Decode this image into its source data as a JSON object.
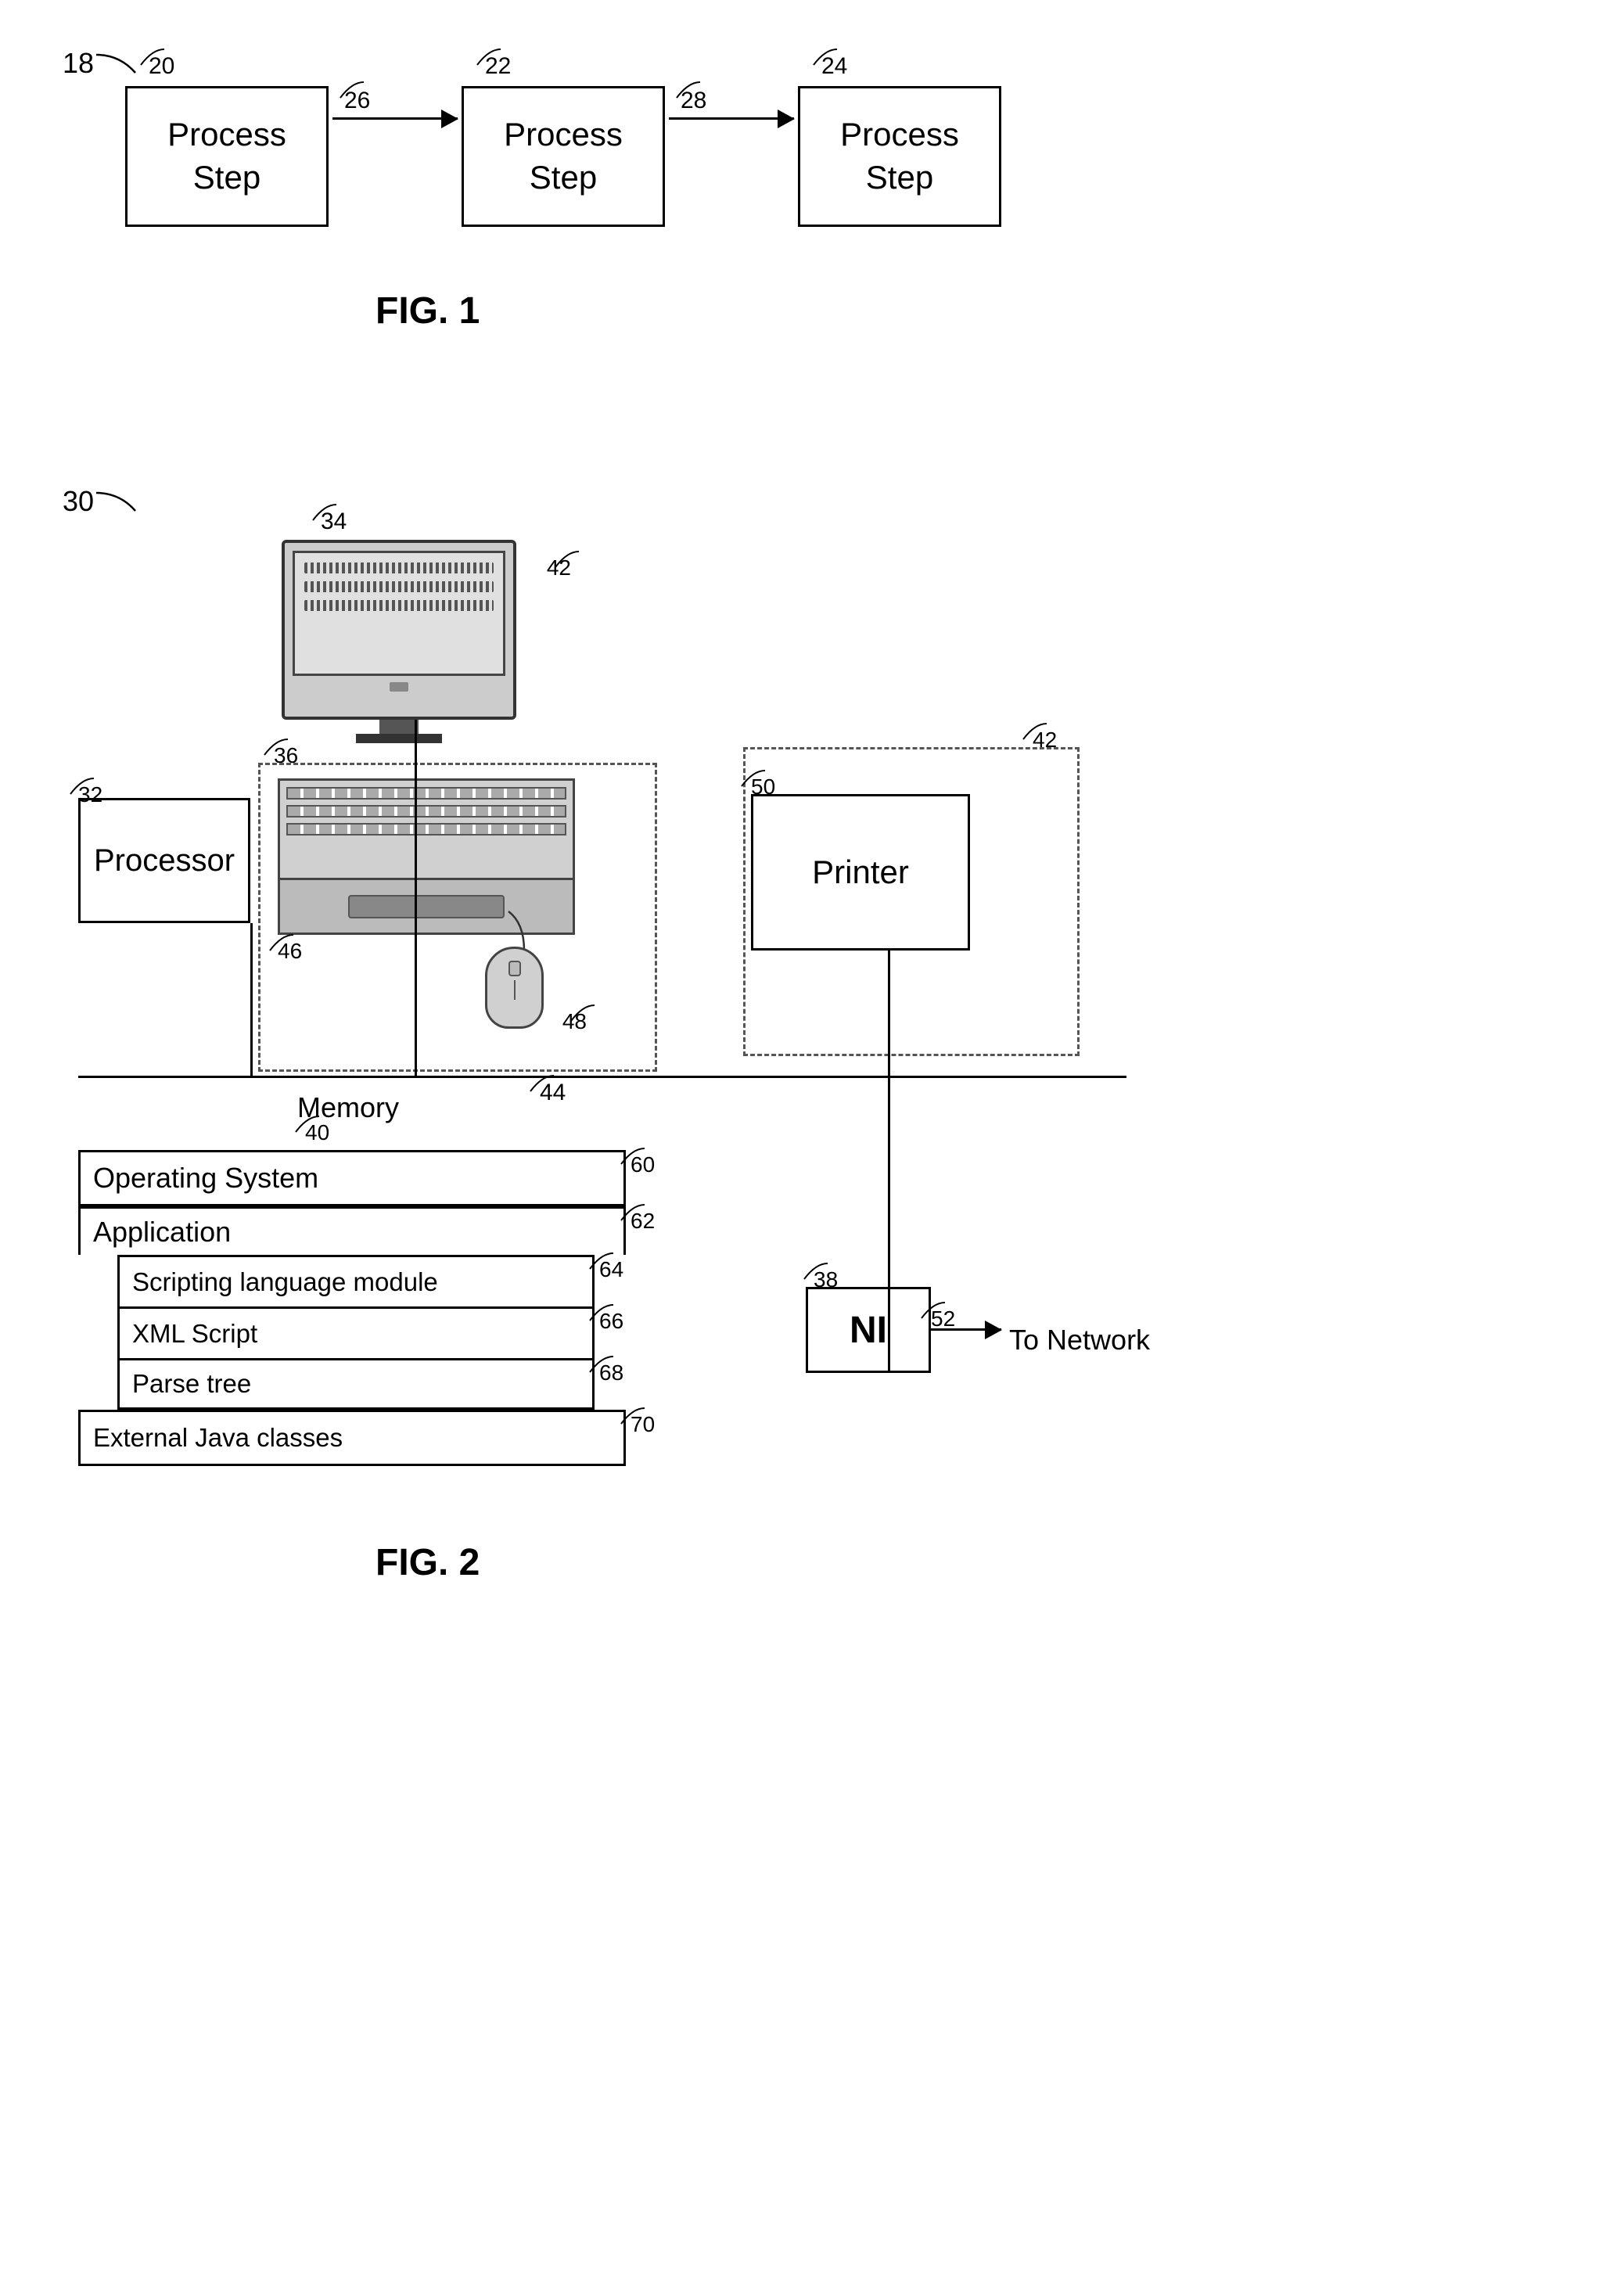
{
  "fig1": {
    "diagram_label": "18",
    "caption": "FIG. 1",
    "boxes": [
      {
        "id": "20",
        "label": "Process\nStep",
        "ref": "20"
      },
      {
        "id": "22",
        "label": "Process\nStep",
        "ref": "22"
      },
      {
        "id": "24",
        "label": "Process\nStep",
        "ref": "24"
      }
    ],
    "arrows": [
      {
        "id": "26",
        "ref": "26"
      },
      {
        "id": "28",
        "ref": "28"
      }
    ]
  },
  "fig2": {
    "diagram_label": "30",
    "caption": "FIG. 2",
    "components": {
      "processor": {
        "label": "Processor",
        "ref": "32"
      },
      "monitor": {
        "label": "34",
        "inner_ref": "42"
      },
      "keyboard_group": {
        "ref": "36"
      },
      "keyboard": {
        "ref": "46"
      },
      "mouse": {
        "ref": "48"
      },
      "bus": {
        "ref": "44"
      },
      "printer_group": {
        "ref": "42"
      },
      "printer": {
        "label": "Printer",
        "ref": "50"
      },
      "ni_box": {
        "label": "NI",
        "ref": "38"
      },
      "to_network": {
        "label": "To Network",
        "ref": "52"
      },
      "memory_label": {
        "label": "Memory",
        "ref": "40"
      },
      "os": {
        "label": "Operating System",
        "ref": "60"
      },
      "application": {
        "label": "Application",
        "ref": "62"
      },
      "scripting": {
        "label": "Scripting language module",
        "ref": "64"
      },
      "xml": {
        "label": "XML Script",
        "ref": "66"
      },
      "parse": {
        "label": "Parse tree",
        "ref": "68"
      },
      "external_java": {
        "label": "External Java classes",
        "ref": "70"
      }
    }
  }
}
